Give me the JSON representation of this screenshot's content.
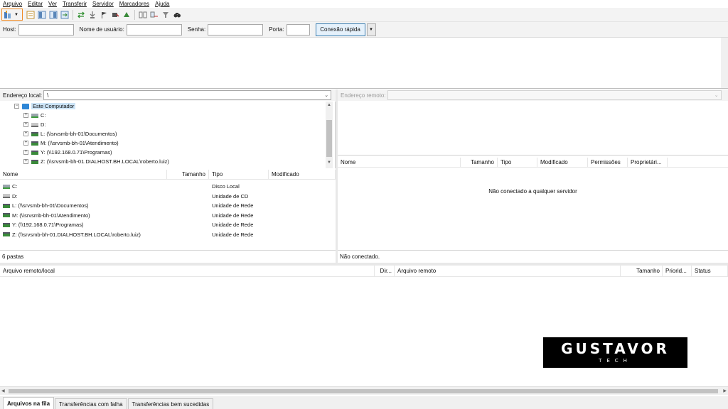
{
  "menu": [
    "Arquivo",
    "Editar",
    "Ver",
    "Transferir",
    "Servidor",
    "Marcadores",
    "Ajuda"
  ],
  "toolbar": {
    "icons": [
      "site-manager-icon",
      "message-log-icon",
      "local-tree-icon",
      "remote-tree-icon",
      "transfer-queue-icon",
      "refresh-icon",
      "process-queue-icon",
      "cancel-icon",
      "disconnect-icon",
      "reconnect-icon",
      "directory-comparison-icon",
      "sync-browsing-icon",
      "recursive-filter-icon",
      "find-files-icon"
    ]
  },
  "quickconnect": {
    "host_label": "Host:",
    "user_label": "Nome de usuário:",
    "pass_label": "Senha:",
    "port_label": "Porta:",
    "host_value": "",
    "user_value": "",
    "pass_value": "",
    "port_value": "",
    "button": "Conexão rápida"
  },
  "local": {
    "address_label": "Endereço local:",
    "address_value": "\\",
    "tree": [
      {
        "label": "Este Computador",
        "icon": "computer-icon",
        "level": 0,
        "expanded": true
      },
      {
        "label": "C:",
        "icon": "disk-icon",
        "level": 1
      },
      {
        "label": "D:",
        "icon": "cd-icon",
        "level": 1
      },
      {
        "label": "L: (\\\\srvsmb-bh-01\\Documentos)",
        "icon": "network-drive-icon",
        "level": 1
      },
      {
        "label": "M: (\\\\srvsmb-bh-01\\Atendimento)",
        "icon": "network-drive-icon",
        "level": 1
      },
      {
        "label": "Y: (\\\\192.168.0.71\\Programas)",
        "icon": "network-drive-icon",
        "level": 1
      },
      {
        "label": "Z: (\\\\srvsmb-bh-01.DIALHOST.BH.LOCAL\\roberto.luiz)",
        "icon": "network-drive-icon",
        "level": 1
      }
    ],
    "columns": [
      "Nome",
      "Tamanho",
      "Tipo",
      "Modificado"
    ],
    "files": [
      {
        "name": "C:",
        "size": "",
        "type": "Disco Local",
        "modified": "",
        "icon": "disk-icon"
      },
      {
        "name": "D:",
        "size": "",
        "type": "Unidade de CD",
        "modified": "",
        "icon": "cd-icon"
      },
      {
        "name": "L: (\\\\srvsmb-bh-01\\Documentos)",
        "size": "",
        "type": "Unidade de Rede",
        "modified": "",
        "icon": "network-drive-icon"
      },
      {
        "name": "M: (\\\\srvsmb-bh-01\\Atendimento)",
        "size": "",
        "type": "Unidade de Rede",
        "modified": "",
        "icon": "network-drive-icon"
      },
      {
        "name": "Y: (\\\\192.168.0.71\\Programas)",
        "size": "",
        "type": "Unidade de Rede",
        "modified": "",
        "icon": "network-drive-icon"
      },
      {
        "name": "Z: (\\\\srvsmb-bh-01.DIALHOST.BH.LOCAL\\roberto.luiz)",
        "size": "",
        "type": "Unidade de Rede",
        "modified": "",
        "icon": "network-drive-icon"
      }
    ],
    "status": "6 pastas"
  },
  "remote": {
    "address_label": "Endereço remoto:",
    "columns": [
      "Nome",
      "Tamanho",
      "Tipo",
      "Modificado",
      "Permissões",
      "Proprietári..."
    ],
    "empty_message": "Não conectado a qualquer servidor",
    "status": "Não conectado."
  },
  "queue": {
    "columns": [
      "Arquivo remoto/local",
      "Dir...",
      "Arquivo remoto",
      "Tamanho",
      "Priorid...",
      "Status"
    ],
    "tabs": [
      "Arquivos na fila",
      "Transferências com falha",
      "Transferências bem sucedidas"
    ]
  },
  "logo": {
    "main": "GUSTAVOR",
    "sub": "TECH"
  }
}
